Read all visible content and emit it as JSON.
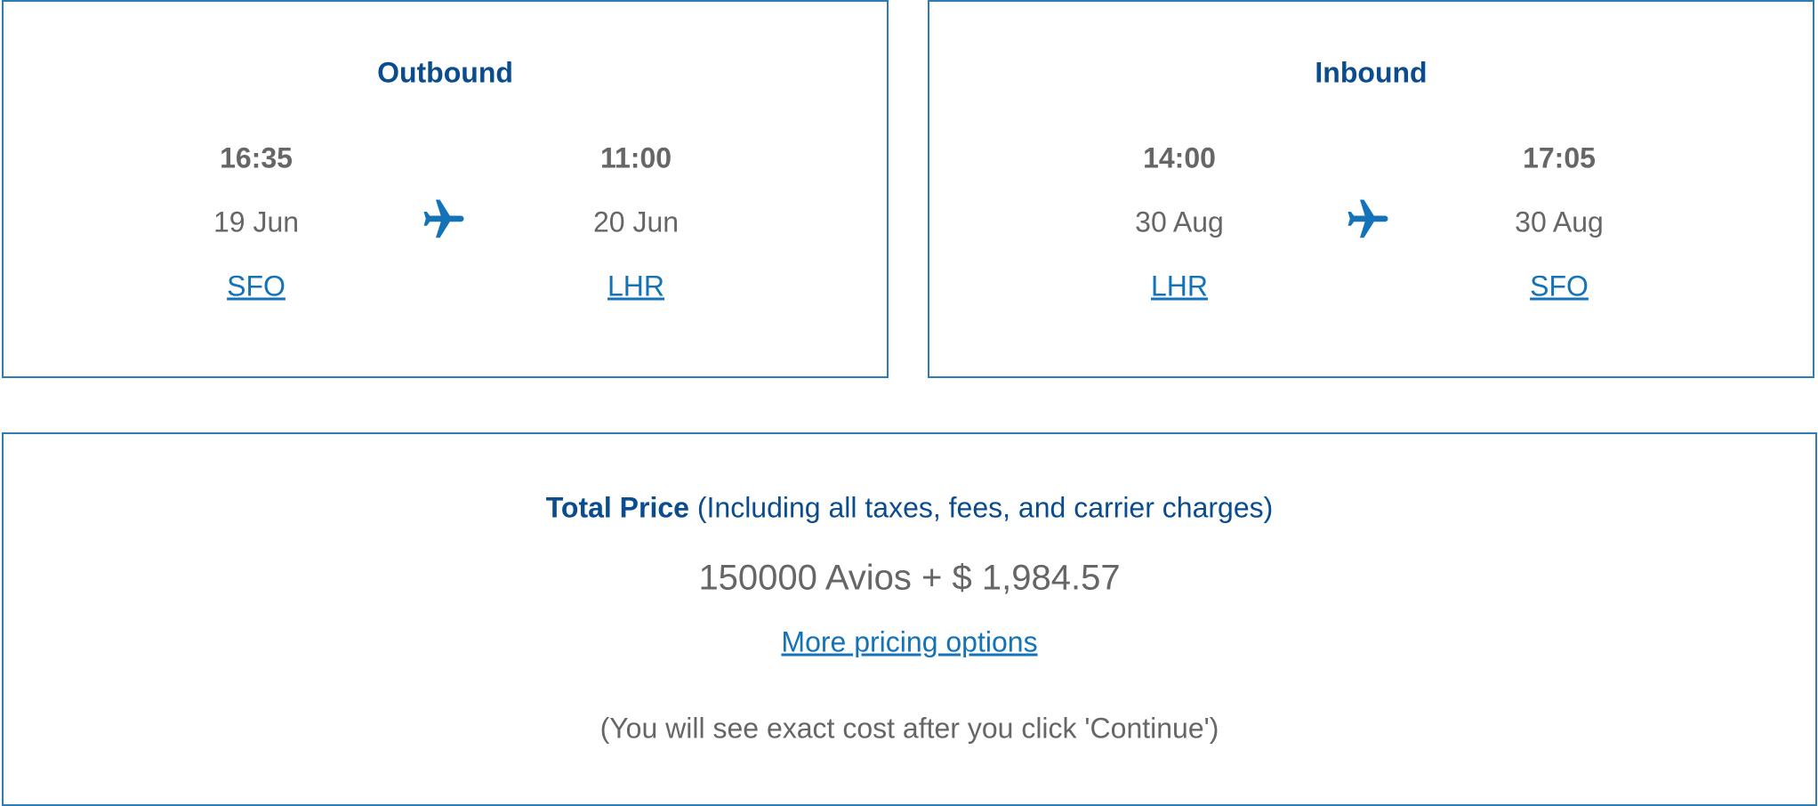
{
  "outbound": {
    "title": "Outbound",
    "departure": {
      "time": "16:35",
      "date": "19 Jun",
      "airport": "SFO"
    },
    "arrival": {
      "time": "11:00",
      "date": "20 Jun",
      "airport": "LHR"
    },
    "icon": "airplane-icon"
  },
  "inbound": {
    "title": "Inbound",
    "departure": {
      "time": "14:00",
      "date": "30 Aug",
      "airport": "LHR"
    },
    "arrival": {
      "time": "17:05",
      "date": "30 Aug",
      "airport": "SFO"
    },
    "icon": "airplane-icon"
  },
  "price": {
    "title_bold": "Total Price",
    "title_rest": " (Including all taxes, fees, and carrier charges)",
    "value": "150000 Avios + $ 1,984.57",
    "more_options_link": "More pricing options",
    "note": "(You will see exact cost after you click 'Continue')"
  },
  "colors": {
    "border": "#2d7cb6",
    "heading": "#0a4c8e",
    "link": "#1372b8",
    "text": "#666666"
  }
}
